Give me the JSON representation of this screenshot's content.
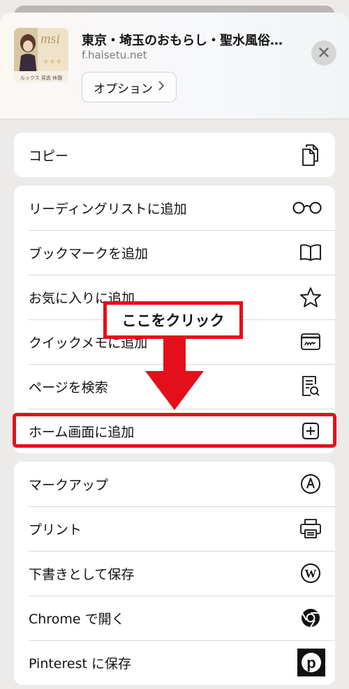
{
  "header": {
    "title": "東京・埼玉のおもらし・聖水風俗…",
    "url": "f.haisetu.net",
    "options_label": "オプション",
    "thumb_logo": "msi",
    "thumb_caption": "ルックス 見逃 休憩"
  },
  "groups": [
    {
      "items": [
        {
          "label": "コピー",
          "icon": "copy-icon"
        }
      ]
    },
    {
      "items": [
        {
          "label": "リーディングリストに追加",
          "icon": "glasses-icon"
        },
        {
          "label": "ブックマークを追加",
          "icon": "book-icon"
        },
        {
          "label": "お気に入りに追加",
          "icon": "star-icon"
        },
        {
          "label": "クイックメモに追加",
          "icon": "quick-note-icon"
        },
        {
          "label": "ページを検索",
          "icon": "find-on-page-icon"
        },
        {
          "label": "ホーム画面に追加",
          "icon": "add-square-icon"
        }
      ]
    },
    {
      "items": [
        {
          "label": "マークアップ",
          "icon": "markup-icon"
        },
        {
          "label": "プリント",
          "icon": "printer-icon"
        },
        {
          "label": "下書きとして保存",
          "icon": "wordpress-icon"
        },
        {
          "label": "Chrome で開く",
          "icon": "chrome-icon"
        },
        {
          "label": "Pinterest に保存",
          "icon": "pinterest-icon"
        }
      ]
    }
  ],
  "annotation": {
    "callout_text": "ここをクリック",
    "highlight_color": "#e3101b"
  }
}
